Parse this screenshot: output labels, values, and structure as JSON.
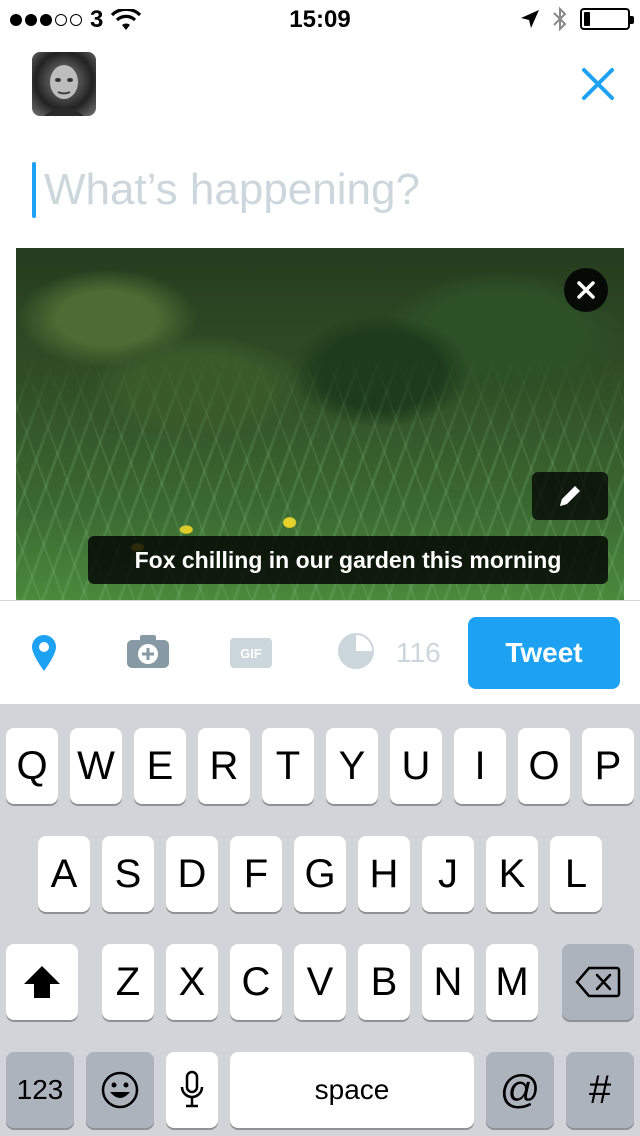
{
  "status_bar": {
    "carrier": "3",
    "time": "15:09",
    "signal_filled": 3,
    "signal_total": 5,
    "battery_level": 0.15
  },
  "compose": {
    "placeholder": "What’s happening?"
  },
  "media": {
    "caption": "Fox chilling in our garden this morning"
  },
  "toolbar": {
    "char_count": "116",
    "tweet_label": "Tweet",
    "icons": [
      "location-icon",
      "camera-icon",
      "gif-icon",
      "counter-ring-icon"
    ],
    "accent_color": "#1da1f2"
  },
  "keyboard": {
    "row1": [
      "Q",
      "W",
      "E",
      "R",
      "T",
      "Y",
      "U",
      "I",
      "O",
      "P"
    ],
    "row2": [
      "A",
      "S",
      "D",
      "F",
      "G",
      "H",
      "J",
      "K",
      "L"
    ],
    "row3": [
      "Z",
      "X",
      "C",
      "V",
      "B",
      "N",
      "M"
    ],
    "numbers_label": "123",
    "space_label": "space",
    "at_label": "@",
    "hash_label": "#"
  }
}
